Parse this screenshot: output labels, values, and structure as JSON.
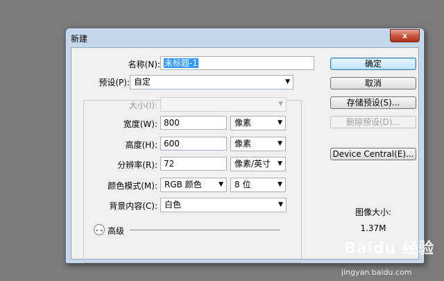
{
  "window": {
    "title": "新建",
    "close_glyph": "x"
  },
  "form": {
    "name": {
      "label": "名称(N):",
      "value": "未标题-1"
    },
    "preset": {
      "label": "预设(P):",
      "value": "自定"
    },
    "size": {
      "label": "大小(I):",
      "value": ""
    },
    "width": {
      "label": "宽度(W):",
      "value": "800",
      "unit": "像素"
    },
    "height": {
      "label": "高度(H):",
      "value": "600",
      "unit": "像素"
    },
    "resolution": {
      "label": "分辨率(R):",
      "value": "72",
      "unit": "像素/英寸"
    },
    "color_mode": {
      "label": "颜色模式(M):",
      "mode": "RGB 颜色",
      "bits": "8 位"
    },
    "background": {
      "label": "背景内容(C):",
      "value": "白色"
    },
    "advanced": {
      "label": "高级"
    }
  },
  "buttons": {
    "ok": "确定",
    "cancel": "取消",
    "save_preset": "存储预设(S)...",
    "delete_preset": "删除预设(D)...",
    "device_central": "Device Central(E)..."
  },
  "image_size": {
    "label": "图像大小:",
    "value": "1.37M"
  },
  "watermark": {
    "brand": "Baidu 经验",
    "url": "jingyan.baidu.com"
  }
}
